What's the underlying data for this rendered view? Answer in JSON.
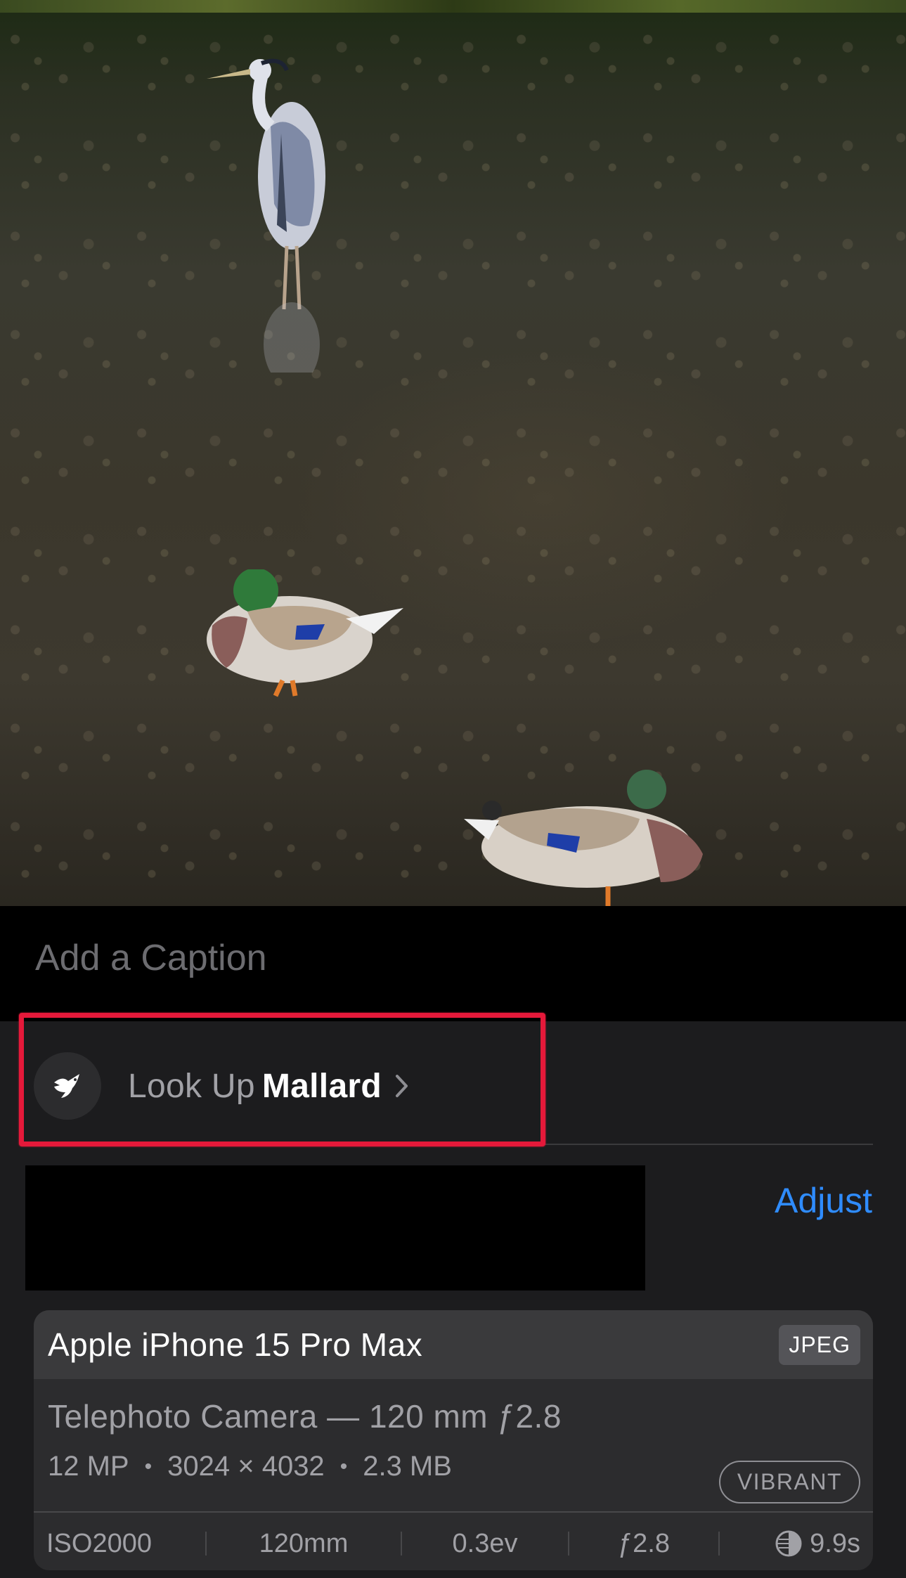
{
  "caption": {
    "placeholder": "Add a Caption"
  },
  "lookup": {
    "prefix": "Look Up",
    "subject": "Mallard"
  },
  "adjust_label": "Adjust",
  "exif": {
    "device": "Apple iPhone 15 Pro Max",
    "format": "JPEG",
    "camera": "Telephoto Camera — 120 mm ƒ2.8",
    "megapixels": "12 MP",
    "resolution": "3024 × 4032",
    "size": "2.3 MB",
    "style": "VIBRANT",
    "iso": "ISO2000",
    "focal_length": "120mm",
    "exposure_bias": "0.3ev",
    "aperture": "ƒ2.8",
    "shutter": "9.9s"
  },
  "colors": {
    "accent": "#2f8cff",
    "highlight": "#e5193a",
    "panel": "#1c1c1e"
  },
  "icons": [
    "bird-icon",
    "chevron-right-icon",
    "night-mode-icon"
  ]
}
